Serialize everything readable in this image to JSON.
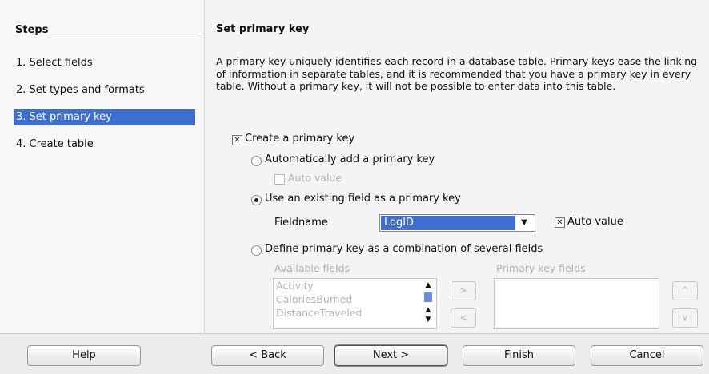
{
  "sidebar": {
    "title": "Steps",
    "items": [
      {
        "label": "1. Select fields",
        "active": false
      },
      {
        "label": "2. Set types and formats",
        "active": false
      },
      {
        "label": "3. Set primary key",
        "active": true
      },
      {
        "label": "4. Create table",
        "active": false
      }
    ]
  },
  "main": {
    "title": "Set primary key",
    "description": "A primary key uniquely identifies each record in a database table. Primary keys ease the linking of information in separate tables, and it is recommended that you have a primary key in every table. Without a primary key, it will not be possible to enter data into this table.",
    "create_pk": {
      "label": "Create a primary key",
      "checked": true
    },
    "auto_add": {
      "label": "Automatically add a primary key",
      "selected": false,
      "auto_value_label": "Auto value",
      "auto_value_checked": false
    },
    "use_existing": {
      "label": "Use an existing field as a primary key",
      "selected": true,
      "fieldname_label": "Fieldname",
      "fieldname_value": "LogID",
      "auto_value_label": "Auto value",
      "auto_value_checked": true
    },
    "combination": {
      "label": "Define primary key as a combination of several fields",
      "selected": false,
      "available_label": "Available fields",
      "available_fields": [
        "Activity",
        "CaloriesBurned",
        "DistanceTraveled"
      ],
      "primary_key_label": "Primary key fields",
      "add_label": ">",
      "remove_label": "<",
      "up_label": "^",
      "down_label": "v"
    }
  },
  "footer": {
    "help": "Help",
    "back": "< Back",
    "next": "Next >",
    "finish": "Finish",
    "cancel": "Cancel"
  }
}
